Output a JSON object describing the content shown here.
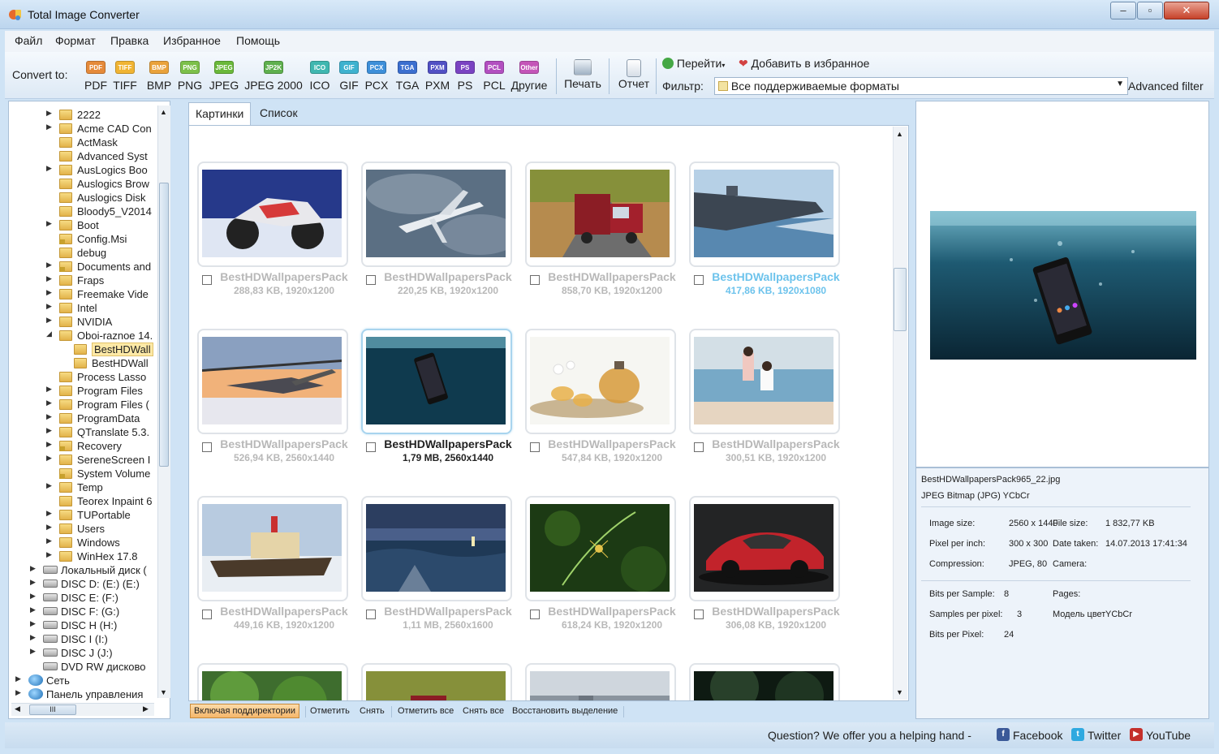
{
  "window": {
    "title": "Total Image Converter"
  },
  "menu": [
    "Файл",
    "Формат",
    "Правка",
    "Избранное",
    "Помощь"
  ],
  "toolbar": {
    "convert_label": "Convert to:",
    "formats": [
      {
        "label": "PDF",
        "icon": "PDF",
        "color": "#e58a3a"
      },
      {
        "label": "TIFF",
        "icon": "TIFF",
        "color": "#f0b433"
      },
      {
        "label": "BMP",
        "icon": "BMP",
        "color": "#e9a23b"
      },
      {
        "label": "PNG",
        "icon": "PNG",
        "color": "#7cc04a"
      },
      {
        "label": "JPEG",
        "icon": "JPEG",
        "color": "#6ab83a"
      },
      {
        "label": "JPEG 2000",
        "icon": "JP2K",
        "color": "#5fb04e"
      },
      {
        "label": "ICO",
        "icon": "ICO",
        "color": "#3fb7b0"
      },
      {
        "label": "GIF",
        "icon": "GIF",
        "color": "#3eb2cf"
      },
      {
        "label": "PCX",
        "icon": "PCX",
        "color": "#3d8fd9"
      },
      {
        "label": "TGA",
        "icon": "TGA",
        "color": "#3b6fcf"
      },
      {
        "label": "PXM",
        "icon": "PXM",
        "color": "#5150c4"
      },
      {
        "label": "PS",
        "icon": "PS",
        "color": "#7a43c2"
      },
      {
        "label": "PCL",
        "icon": "PCL",
        "color": "#b24fc0"
      },
      {
        "label": "Другие",
        "icon": "Other",
        "color": "#c455b8"
      }
    ],
    "print_label": "Печать",
    "report_label": "Отчет",
    "go_label": "Перейти",
    "favorite_label": "Добавить в избранное",
    "filter_label": "Фильтр:",
    "filter_value": "Все поддерживаемые форматы",
    "advanced_filter": "Advanced filter"
  },
  "tree": [
    {
      "label": "2222",
      "arrow": true,
      "icon": "folder"
    },
    {
      "label": "Acme CAD Con",
      "arrow": true,
      "icon": "folder"
    },
    {
      "label": "ActMask",
      "arrow": false,
      "icon": "folder"
    },
    {
      "label": "Advanced Syst",
      "arrow": false,
      "icon": "folder"
    },
    {
      "label": "AusLogics Boo",
      "arrow": true,
      "icon": "folder"
    },
    {
      "label": "Auslogics Brow",
      "arrow": false,
      "icon": "folder"
    },
    {
      "label": "Auslogics Disk",
      "arrow": false,
      "icon": "folder"
    },
    {
      "label": "Bloody5_V2014",
      "arrow": false,
      "icon": "folder"
    },
    {
      "label": "Boot",
      "arrow": true,
      "icon": "folder"
    },
    {
      "label": "Config.Msi",
      "arrow": false,
      "icon": "lockfolder"
    },
    {
      "label": "debug",
      "arrow": false,
      "icon": "folder"
    },
    {
      "label": "Documents and",
      "arrow": true,
      "icon": "lockfolder"
    },
    {
      "label": "Fraps",
      "arrow": true,
      "icon": "folder"
    },
    {
      "label": "Freemake Vide",
      "arrow": true,
      "icon": "folder"
    },
    {
      "label": "Intel",
      "arrow": true,
      "icon": "folder"
    },
    {
      "label": "NVIDIA",
      "arrow": true,
      "icon": "folder"
    },
    {
      "label": "Oboi-raznoe 14.",
      "arrow": "open",
      "icon": "folder"
    },
    {
      "label": "BestHDWall",
      "arrow": false,
      "icon": "folder",
      "indent": true,
      "selected": true
    },
    {
      "label": "BestHDWall",
      "arrow": false,
      "icon": "folder",
      "indent": true
    },
    {
      "label": "Process Lasso",
      "arrow": false,
      "icon": "folder"
    },
    {
      "label": "Program Files",
      "arrow": true,
      "icon": "folder"
    },
    {
      "label": "Program Files (",
      "arrow": true,
      "icon": "folder"
    },
    {
      "label": "ProgramData",
      "arrow": true,
      "icon": "folder"
    },
    {
      "label": "QTranslate 5.3.",
      "arrow": true,
      "icon": "folder"
    },
    {
      "label": "Recovery",
      "arrow": true,
      "icon": "lockfolder"
    },
    {
      "label": "SereneScreen I",
      "arrow": true,
      "icon": "folder"
    },
    {
      "label": "System Volume",
      "arrow": false,
      "icon": "lockfolder"
    },
    {
      "label": "Temp",
      "arrow": true,
      "icon": "folder"
    },
    {
      "label": "Teorex Inpaint 6",
      "arrow": false,
      "icon": "folder"
    },
    {
      "label": "TUPortable",
      "arrow": true,
      "icon": "folder"
    },
    {
      "label": "Users",
      "arrow": true,
      "icon": "folder"
    },
    {
      "label": "Windows",
      "arrow": true,
      "icon": "folder"
    },
    {
      "label": "WinHex 17.8",
      "arrow": true,
      "icon": "folder"
    },
    {
      "label": "Локальный диск (",
      "arrow": true,
      "icon": "disk",
      "level": 0
    },
    {
      "label": "DISC D: (E:) (E:)",
      "arrow": true,
      "icon": "disk",
      "level": 0
    },
    {
      "label": "DISC E: (F:)",
      "arrow": true,
      "icon": "disk",
      "level": 0
    },
    {
      "label": "DISC F: (G:)",
      "arrow": true,
      "icon": "disk",
      "level": 0
    },
    {
      "label": "DISC H (H:)",
      "arrow": true,
      "icon": "disk",
      "level": 0
    },
    {
      "label": "DISC I (I:)",
      "arrow": true,
      "icon": "disk",
      "level": 0
    },
    {
      "label": "DISC J (J:)",
      "arrow": true,
      "icon": "disk",
      "level": 0
    },
    {
      "label": "DVD RW дисково",
      "arrow": false,
      "icon": "disk",
      "level": 0
    },
    {
      "label": "Сеть",
      "arrow": true,
      "icon": "net",
      "level": -1
    },
    {
      "label": "Панель управления",
      "arrow": true,
      "icon": "net",
      "level": -1
    }
  ],
  "tabs": [
    "Картинки",
    "Список"
  ],
  "images": [
    {
      "name": "BestHDWallpapersPack",
      "info": "288,83 KB, 1920x1200",
      "style": "dim",
      "scene": "moto"
    },
    {
      "name": "BestHDWallpapersPack",
      "info": "220,25 KB, 1920x1200",
      "style": "dim",
      "scene": "plane"
    },
    {
      "name": "BestHDWallpapersPack",
      "info": "858,70 KB, 1920x1200",
      "style": "dim",
      "scene": "truck"
    },
    {
      "name": "BestHDWallpapersPack",
      "info": "417,86 KB, 1920x1080",
      "style": "blue",
      "scene": "ship"
    },
    {
      "name": "BestHDWallpapersPack",
      "info": "526,94 KB, 2560x1440",
      "style": "dim",
      "scene": "heli"
    },
    {
      "name": "BestHDWallpapersPack",
      "info": "1,79 MB, 2560x1440",
      "style": "dark",
      "scene": "phone",
      "active": true
    },
    {
      "name": "BestHDWallpapersPack",
      "info": "547,84 KB, 1920x1200",
      "style": "dim",
      "scene": "tea"
    },
    {
      "name": "BestHDWallpapersPack",
      "info": "300,51 KB, 1920x1200",
      "style": "dim",
      "scene": "beach"
    },
    {
      "name": "BestHDWallpapersPack",
      "info": "449,16 KB, 1920x1200",
      "style": "dim",
      "scene": "icebreaker"
    },
    {
      "name": "BestHDWallpapersPack",
      "info": "1,11 MB, 2560x1600",
      "style": "dim",
      "scene": "sea"
    },
    {
      "name": "BestHDWallpapersPack",
      "info": "618,24 KB, 1920x1200",
      "style": "dim",
      "scene": "spider"
    },
    {
      "name": "BestHDWallpapersPack",
      "info": "306,08 KB, 1920x1200",
      "style": "dim",
      "scene": "car"
    },
    {
      "name": "",
      "info": "",
      "style": "dim",
      "scene": "tree"
    },
    {
      "name": "",
      "info": "",
      "style": "dim",
      "scene": "truck"
    },
    {
      "name": "",
      "info": "",
      "style": "dim",
      "scene": "city"
    },
    {
      "name": "",
      "info": "",
      "style": "dim",
      "scene": "forest"
    }
  ],
  "bottombar": {
    "subdirs": "Включая поддиректории",
    "check": "Отметить",
    "uncheck": "Снять",
    "check_all": "Отметить все",
    "uncheck_all": "Снять все",
    "restore": "Восстановить выделение"
  },
  "info": {
    "filename": "BestHDWallpapersPack965_22.jpg",
    "format": "JPEG Bitmap (JPG) YCbCr",
    "image_size_label": "Image size:",
    "image_size": "2560 x 1440",
    "file_size_label": "File size:",
    "file_size": "1 832,77 KB",
    "ppi_label": "Pixel per inch:",
    "ppi": "300 x 300",
    "date_label": "Date taken:",
    "date": "14.07.2013 17:41:34",
    "compression_label": "Compression:",
    "compression": "JPEG, 80",
    "camera_label": "Camera:",
    "camera": "",
    "bps_label": "Bits per Sample:",
    "bps": "8",
    "pages_label": "Pages:",
    "pages": "",
    "spp_label": "Samples per pixel:",
    "spp": "3",
    "color_model_label": "Модель цвет",
    "color_model": "YCbCr",
    "bpp_label": "Bits per Pixel:",
    "bpp": "24"
  },
  "status": {
    "question": "Question? We offer you a helping hand -",
    "facebook": "Facebook",
    "twitter": "Twitter",
    "youtube": "YouTube"
  }
}
